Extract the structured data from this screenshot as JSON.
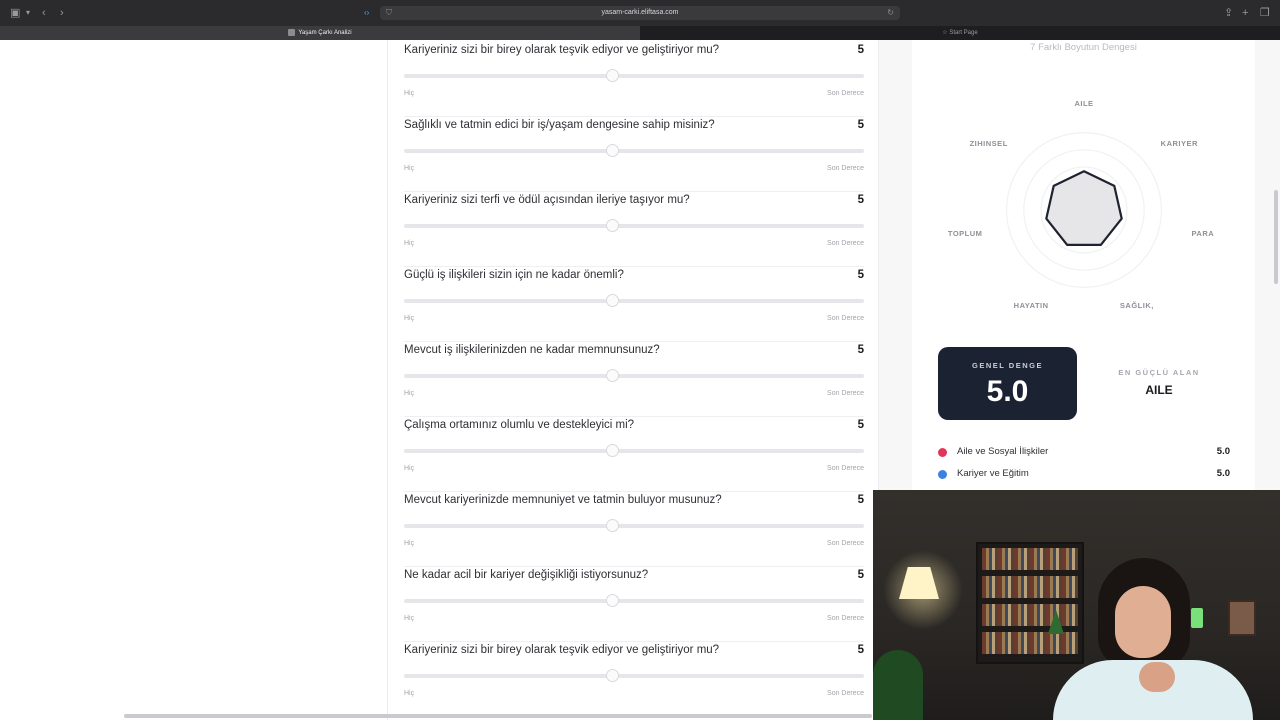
{
  "browser": {
    "url": "yasam-carki.eliftasa.com",
    "tabs": [
      {
        "label": "Yaşam Çarkı Analizi",
        "active": true
      },
      {
        "label": "Start Page",
        "active": false
      }
    ]
  },
  "questions": {
    "scale_min_label": "Hiç",
    "scale_max_label": "Son Derece",
    "items": [
      {
        "text": "Kariyeriniz sizi bir birey olarak teşvik ediyor ve geliştiriyor mu?",
        "value": "5"
      },
      {
        "text": "Sağlıklı ve tatmin edici bir iş/yaşam dengesine sahip misiniz?",
        "value": "5"
      },
      {
        "text": "Kariyeriniz sizi terfi ve ödül açısından ileriye taşıyor mu?",
        "value": "5"
      },
      {
        "text": "Güçlü iş ilişkileri sizin için ne kadar önemli?",
        "value": "5"
      },
      {
        "text": "Mevcut iş ilişkilerinizden ne kadar memnunsunuz?",
        "value": "5"
      },
      {
        "text": "Çalışma ortamınız olumlu ve destekleyici mi?",
        "value": "5"
      },
      {
        "text": "Mevcut kariyerinizde memnuniyet ve tatmin buluyor musunuz?",
        "value": "5"
      },
      {
        "text": "Ne kadar acil bir kariyer değişikliği istiyorsunuz?",
        "value": "5"
      },
      {
        "text": "Kariyeriniz sizi bir birey olarak teşvik ediyor ve geliştiriyor mu?",
        "value": "5"
      }
    ],
    "slider_fraction": 0.44
  },
  "panel": {
    "subtitle": "7 Farklı Boyutun Dengesi",
    "radar": {
      "axes": [
        "AILE",
        "KARIYER",
        "PARA",
        "SAĞLIK,",
        "HAYATIN",
        "TOPLUM",
        "ZIHINSEL"
      ],
      "values": [
        5,
        5,
        5,
        5,
        5,
        5,
        5
      ],
      "max": 10
    },
    "balance": {
      "label": "GENEL DENGE",
      "value": "5.0"
    },
    "strongest": {
      "label": "EN GÜÇLÜ ALAN",
      "value": "AILE"
    },
    "legend": [
      {
        "name": "Aile ve Sosyal İlişkiler",
        "value": "5.0",
        "color": "#e0365a"
      },
      {
        "name": "Kariyer ve Eğitim",
        "value": "5.0",
        "color": "#3b82e0"
      }
    ]
  }
}
